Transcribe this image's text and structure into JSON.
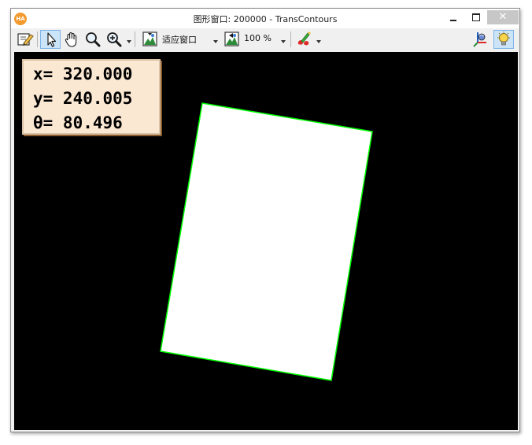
{
  "window": {
    "title": "图形窗口: 200000 - TransContours",
    "app_icon_text": "HA",
    "close_glyph": "✕"
  },
  "toolbar": {
    "icons": [
      "edit-settings-icon",
      "pointer-icon",
      "pan-hand-icon",
      "magnify-icon",
      "zoom-in-icon",
      "fit-window-icon",
      "zoom-percent-icon",
      "draw-color-icon",
      "axis-3d-icon",
      "info-bulb-icon"
    ],
    "fit_window_label": "适应窗口",
    "zoom_label": "100 %"
  },
  "readout": {
    "x_line": "x= 320.000",
    "y_line": "y= 240.005",
    "theta_line": "θ= 80.496"
  },
  "colors": {
    "canvas_bg": "#000000",
    "rect_fill": "#ffffff",
    "contour": "#00ff00",
    "readout_bg": "#fbe8d3"
  }
}
